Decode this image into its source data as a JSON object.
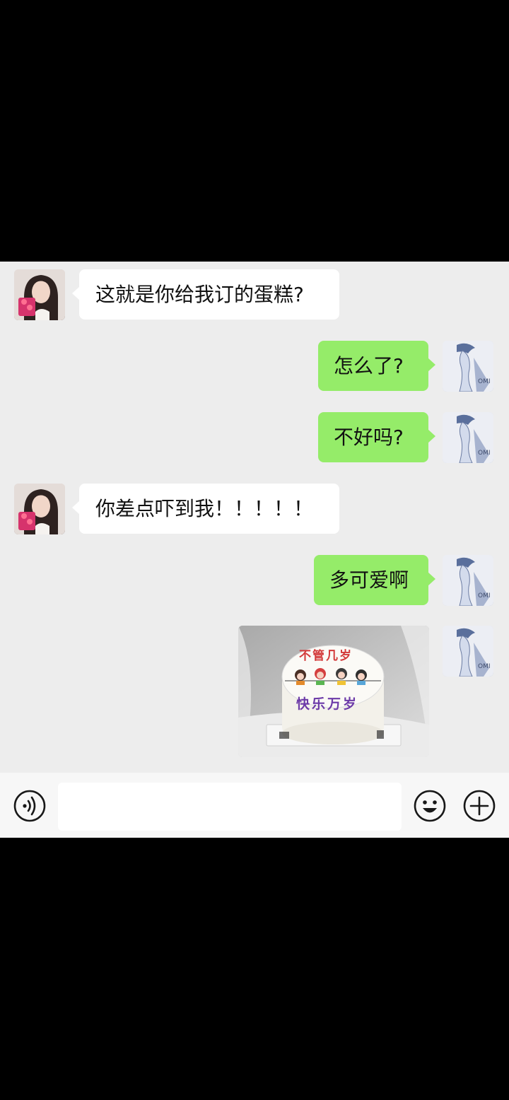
{
  "messages": [
    {
      "side": "in",
      "text": "这就是你给我订的蛋糕?"
    },
    {
      "side": "out",
      "text": "怎么了?"
    },
    {
      "side": "out",
      "text": "不好吗?"
    },
    {
      "side": "in",
      "text": "你差点吓到我！！！！！"
    },
    {
      "side": "out",
      "text": "多可爱啊"
    },
    {
      "side": "out",
      "type": "image",
      "cake_top_text": "不管几岁",
      "cake_bottom_text": "快乐万岁"
    }
  ],
  "input": {
    "value": "",
    "placeholder": ""
  },
  "icons": [
    "voice-icon",
    "emoji-icon",
    "plus-icon"
  ],
  "colors": {
    "chat_bg": "#ededed",
    "bubble_out": "#95ec69",
    "bubble_in": "#ffffff"
  }
}
